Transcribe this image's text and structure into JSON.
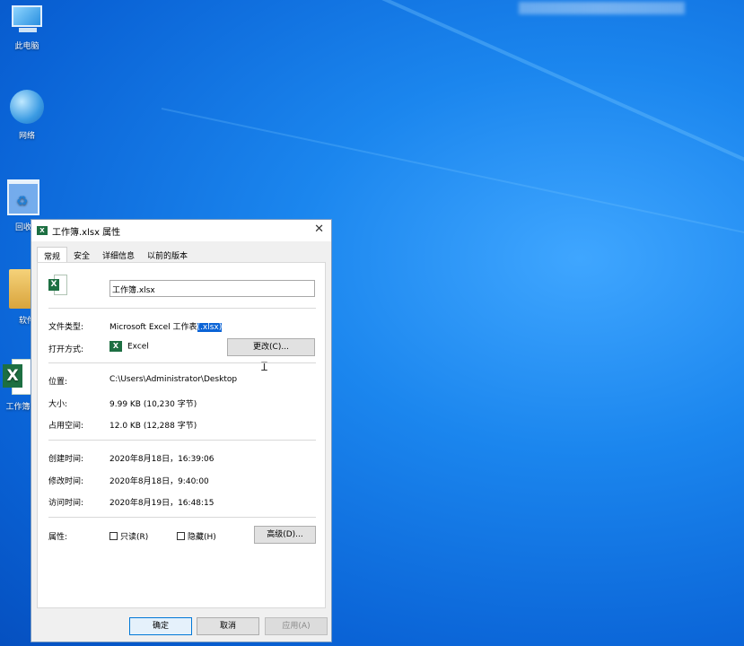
{
  "desktop": {
    "icons": [
      {
        "label": "此电脑"
      },
      {
        "label": "网络"
      },
      {
        "label": "回收"
      },
      {
        "label": "软件"
      },
      {
        "label": "工作簿"
      }
    ]
  },
  "dialog": {
    "title": "工作簿.xlsx 属性",
    "tabs": [
      "常规",
      "安全",
      "详细信息",
      "以前的版本"
    ],
    "active_tab": "常规",
    "file_name": "工作簿.xlsx",
    "type_label": "文件类型:",
    "type_value_prefix": "Microsoft Excel 工作表",
    "type_value_selected": "(.xlsx)",
    "open_with_label": "打开方式:",
    "open_with_value": "Excel",
    "change_button": "更改(C)...",
    "location_label": "位置:",
    "location_value": "C:\\Users\\Administrator\\Desktop",
    "size_label": "大小:",
    "size_value": "9.99 KB (10,230 字节)",
    "disk_size_label": "占用空间:",
    "disk_size_value": "12.0 KB (12,288 字节)",
    "created_label": "创建时间:",
    "created_value": "2020年8月18日，16:39:06",
    "modified_label": "修改时间:",
    "modified_value": "2020年8月18日，9:40:00",
    "accessed_label": "访问时间:",
    "accessed_value": "2020年8月19日，16:48:15",
    "attributes_label": "属性:",
    "readonly_label": "只读(R)",
    "hidden_label": "隐藏(H)",
    "advanced_button": "高级(D)...",
    "ok_button": "确定",
    "cancel_button": "取消",
    "apply_button": "应用(A)"
  },
  "colors": {
    "desktop_blue": "#1b86ee",
    "excel_green": "#1d6f42",
    "selection": "#0a63d6"
  }
}
